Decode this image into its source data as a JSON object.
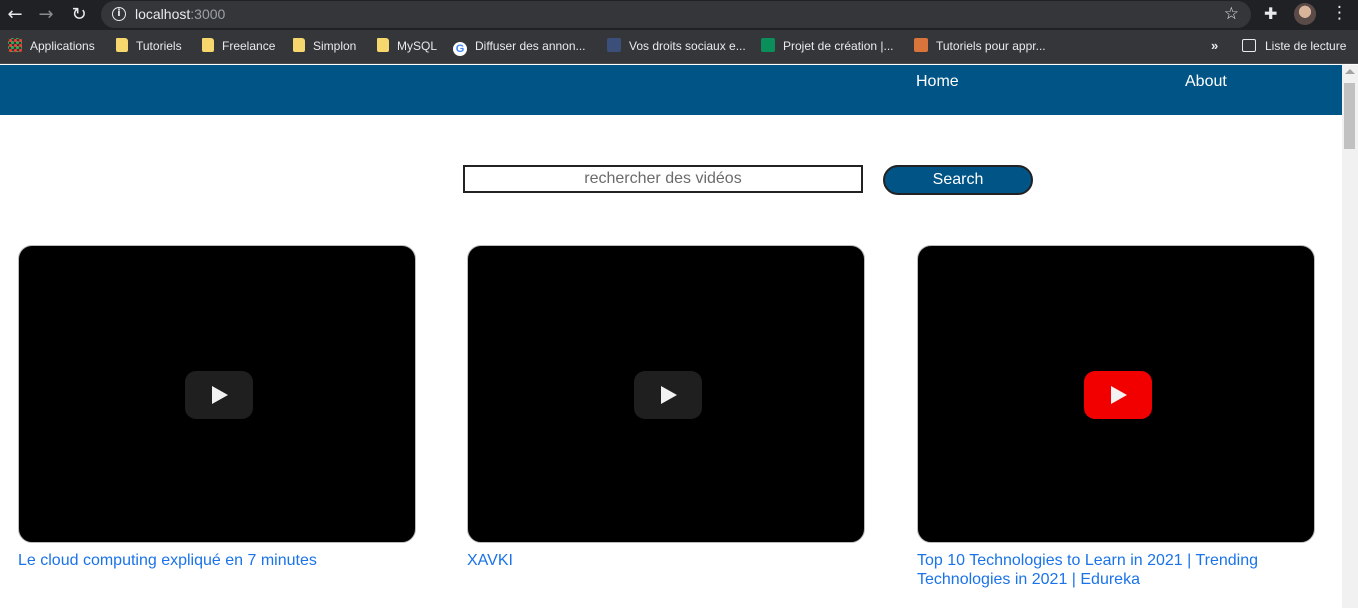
{
  "browser": {
    "url_host": "localhost",
    "url_port": ":3000",
    "bookmarks": [
      {
        "label": "Applications",
        "icon": "apps-grid-icon"
      },
      {
        "label": "Tutoriels",
        "icon": "folder-icon"
      },
      {
        "label": "Freelance",
        "icon": "folder-icon"
      },
      {
        "label": "Simplon",
        "icon": "folder-icon"
      },
      {
        "label": "MySQL",
        "icon": "folder-icon"
      },
      {
        "label": "Diffuser des annon...",
        "icon": "google-icon"
      },
      {
        "label": "Vos droits sociaux e...",
        "icon": "site-icon"
      },
      {
        "label": "Projet de création |...",
        "icon": "site-icon"
      },
      {
        "label": "Tutoriels pour appr...",
        "icon": "site-icon"
      }
    ],
    "reading_list": "Liste de lecture"
  },
  "site": {
    "nav": {
      "home": "Home",
      "about": "About"
    },
    "search": {
      "placeholder": "rechercher des vidéos",
      "button": "Search"
    },
    "videos": [
      {
        "title": "Le cloud computing expliqué en 7 minutes"
      },
      {
        "title": "XAVKI"
      },
      {
        "title": "Top 10 Technologies to Learn in 2021 | Trending Technologies in 2021 | Edureka"
      }
    ]
  },
  "colors": {
    "navbar": "#005486",
    "link": "#1a73e8",
    "play_active": "#ff0000"
  }
}
